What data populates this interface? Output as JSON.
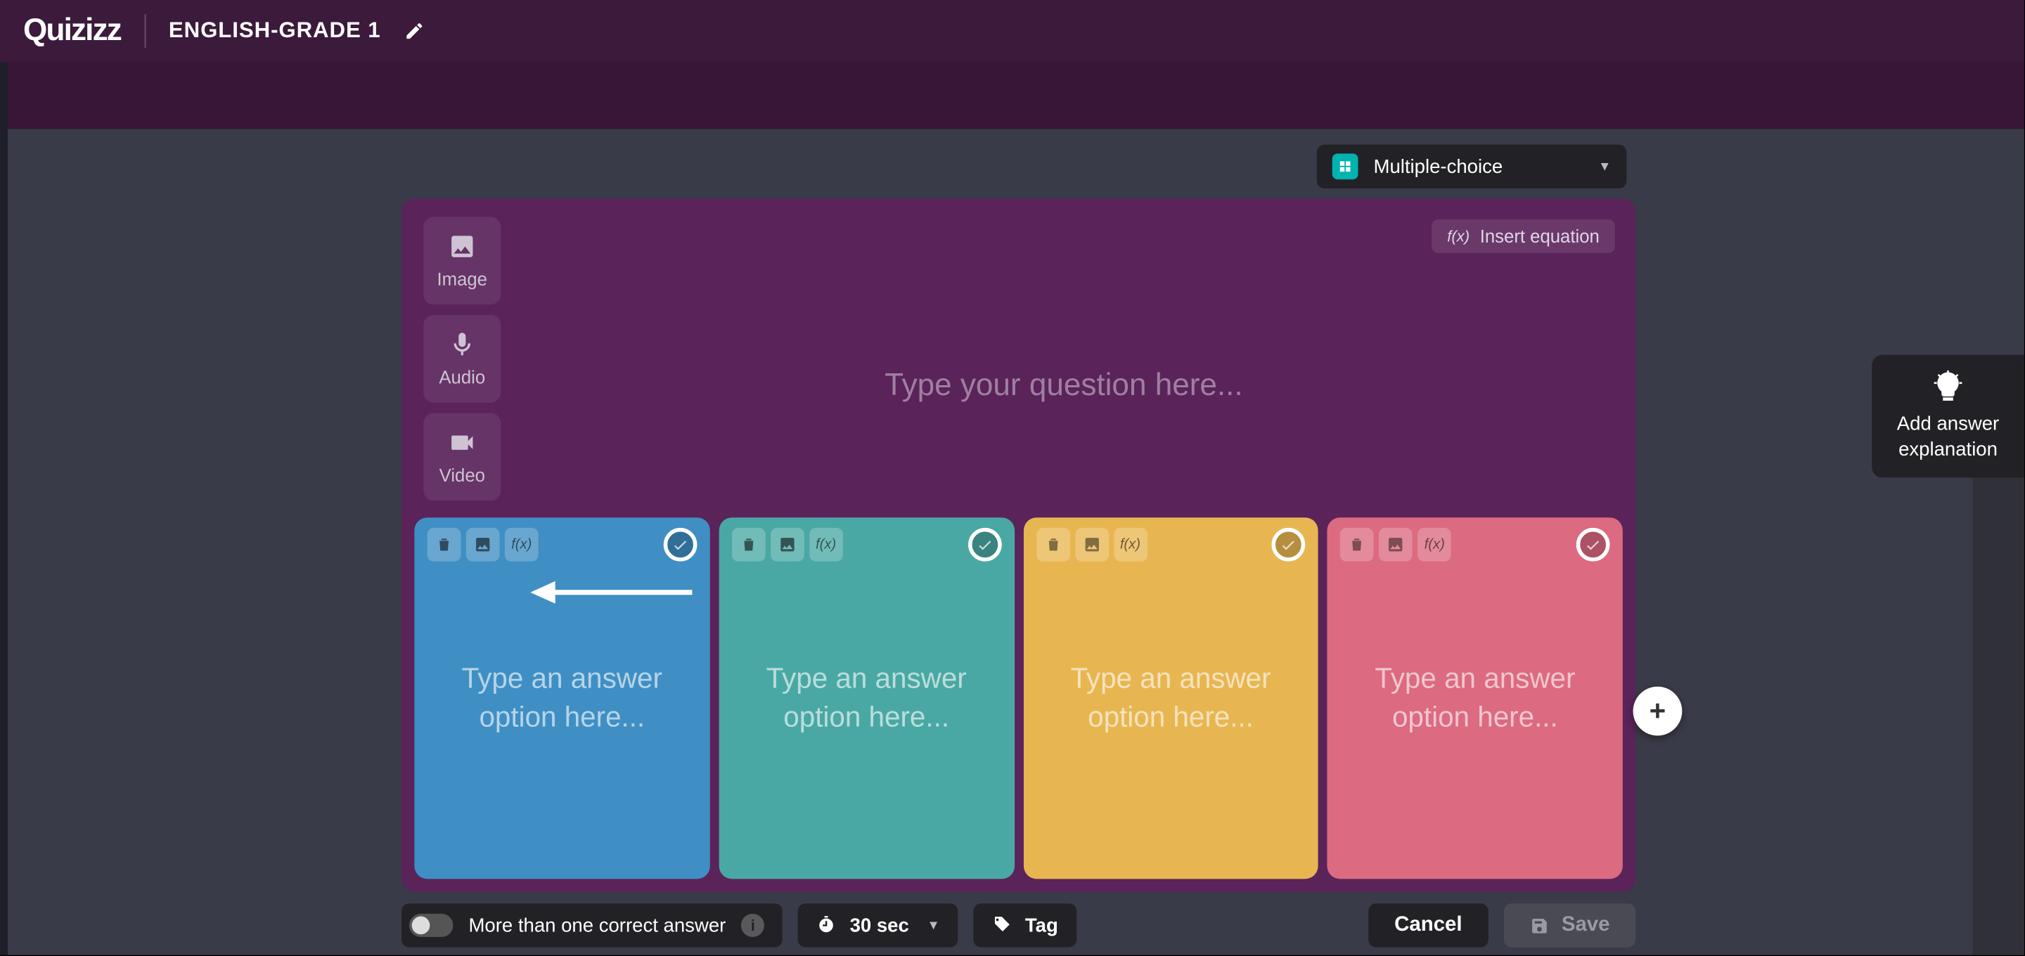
{
  "brand": "Quizizz",
  "quiz_title": "ENGLISH-GRADE 1",
  "question_type": {
    "label": "Multiple-choice"
  },
  "insert_equation_label": "Insert equation",
  "media": {
    "image": "Image",
    "audio": "Audio",
    "video": "Video"
  },
  "question_placeholder": "Type your question here...",
  "answer_placeholder": "Type an answer option here...",
  "answers": [
    {
      "color": "blue"
    },
    {
      "color": "teal"
    },
    {
      "color": "gold"
    },
    {
      "color": "red"
    }
  ],
  "footer": {
    "multi_correct_label": "More than one correct answer",
    "timer_label": "30 sec",
    "tag_label": "Tag",
    "cancel_label": "Cancel",
    "save_label": "Save"
  },
  "explanation": {
    "line1": "Add answer",
    "line2": "explanation"
  }
}
